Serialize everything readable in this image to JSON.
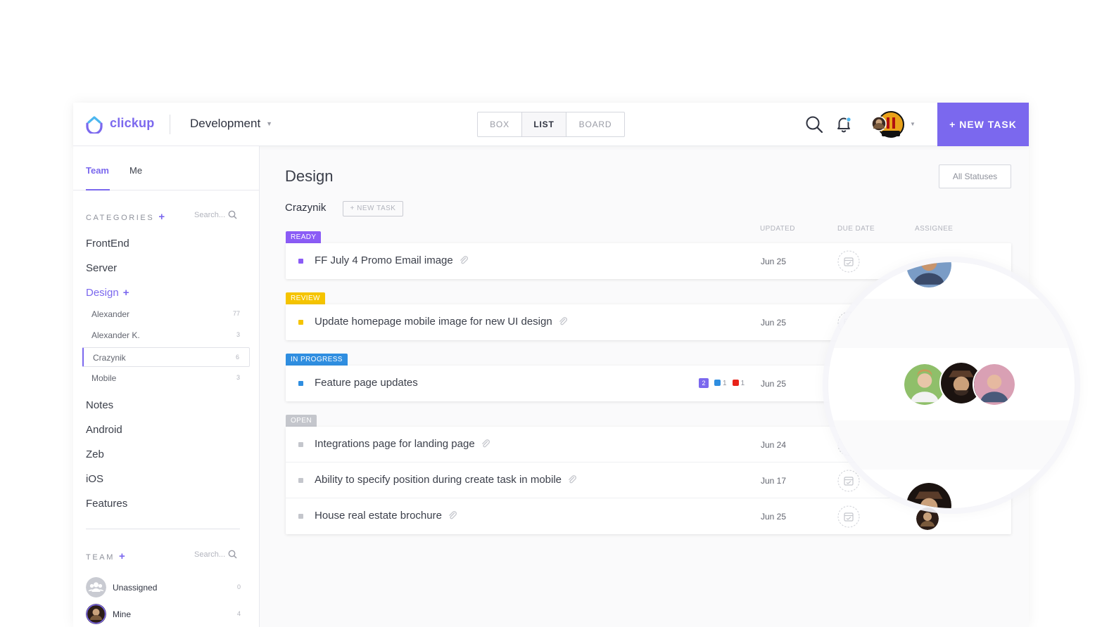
{
  "header": {
    "logo_text": "clickup",
    "project": "Development",
    "views": [
      "BOX",
      "LIST",
      "BOARD"
    ],
    "active_view": "LIST",
    "new_task_label": "+ NEW TASK"
  },
  "sidebar": {
    "tabs": [
      "Team",
      "Me"
    ],
    "categories_heading": "CATEGORIES",
    "search_placeholder": "Search...",
    "categories": [
      "FrontEnd",
      "Server",
      "Design",
      "Notes",
      "Android",
      "Zeb",
      "iOS",
      "Features"
    ],
    "active_category": "Design",
    "design_lists": [
      {
        "label": "Alexander",
        "count": "77"
      },
      {
        "label": "Alexander K.",
        "count": "3"
      },
      {
        "label": "Crazynik",
        "count": "6"
      },
      {
        "label": "Mobile",
        "count": "3"
      }
    ],
    "team_heading": "TEAM",
    "team_search_placeholder": "Search...",
    "members": [
      {
        "name": "Unassigned",
        "count": "0"
      },
      {
        "name": "Mine",
        "count": "4"
      }
    ]
  },
  "main": {
    "title": "Design",
    "all_statuses": "All Statuses",
    "list_name": "Crazynik",
    "new_task_small": "+ NEW TASK",
    "columns": {
      "updated": "UPDATED",
      "due_date": "DUE DATE",
      "assignee": "ASSIGNEE"
    },
    "groups": [
      {
        "status": "READY",
        "color": "#8b5cf6",
        "tasks": [
          {
            "name": "FF July 4 Promo Email image",
            "updated": "Jun 25"
          }
        ]
      },
      {
        "status": "REVIEW",
        "color": "#f5c400",
        "tasks": [
          {
            "name": "Update homepage mobile image for new UI design",
            "updated": "Jun 25"
          }
        ]
      },
      {
        "status": "IN PROGRESS",
        "color": "#2f8ee0",
        "tasks": [
          {
            "name": "Feature page updates",
            "updated": "Jun 25",
            "badges": {
              "count": "2",
              "blue": "1",
              "red": "1"
            }
          }
        ]
      },
      {
        "status": "OPEN",
        "color": "#c4c6cc",
        "tasks": [
          {
            "name": "Integrations page for landing page",
            "updated": "Jun 24"
          },
          {
            "name": "Ability to specify position during create task in mobile",
            "updated": "Jun 17"
          },
          {
            "name": "House real estate brochure",
            "updated": "Jun 25"
          }
        ]
      }
    ]
  },
  "colors": {
    "accent": "#7b68ee"
  }
}
